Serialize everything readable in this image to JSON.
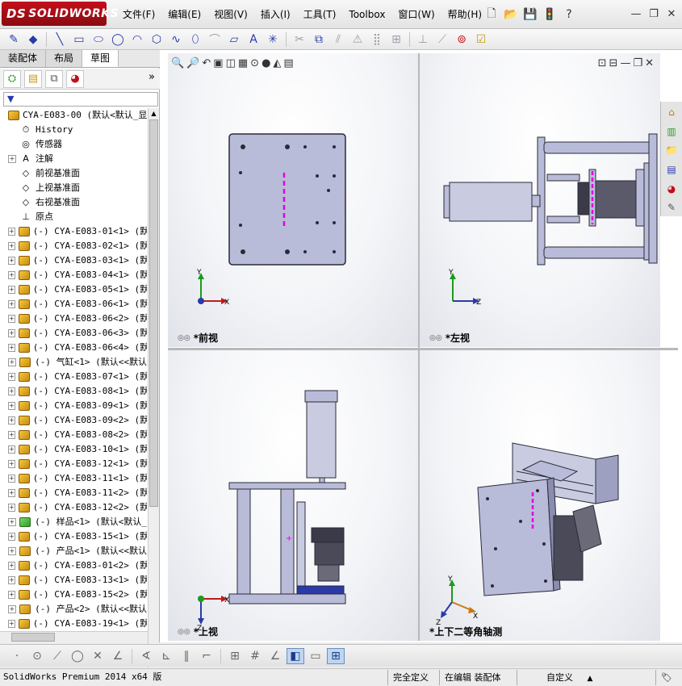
{
  "app": {
    "brand": "SOLIDWORKS",
    "brand_prefix": "DS"
  },
  "menu": [
    "文件(F)",
    "编辑(E)",
    "视图(V)",
    "插入(I)",
    "工具(T)",
    "Toolbox",
    "窗口(W)",
    "帮助(H)"
  ],
  "tabs": [
    {
      "label": "装配体",
      "active": false
    },
    {
      "label": "布局",
      "active": false
    },
    {
      "label": "草图",
      "active": true
    }
  ],
  "tree": {
    "filter_icon": "filter-icon",
    "root": "CYA-E083-00  (默认<默认_显",
    "fixed_items": [
      {
        "label": "History",
        "icon": "history-icon",
        "expand": false
      },
      {
        "label": "传感器",
        "icon": "sensor-icon",
        "expand": false
      },
      {
        "label": "注解",
        "icon": "annotation-icon",
        "expand": true
      },
      {
        "label": "前视基准面",
        "icon": "plane-icon",
        "expand": false
      },
      {
        "label": "上视基准面",
        "icon": "plane-icon",
        "expand": false
      },
      {
        "label": "右视基准面",
        "icon": "plane-icon",
        "expand": false
      },
      {
        "label": "原点",
        "icon": "origin-icon",
        "expand": false
      }
    ],
    "components": [
      {
        "label": "(-) CYA-E083-01<1> (默认",
        "color": "yellow"
      },
      {
        "label": "(-) CYA-E083-02<1> (默认",
        "color": "yellow"
      },
      {
        "label": "(-) CYA-E083-03<1> (默认",
        "color": "yellow"
      },
      {
        "label": "(-) CYA-E083-04<1> (默认",
        "color": "yellow"
      },
      {
        "label": "(-) CYA-E083-05<1> (默认",
        "color": "yellow"
      },
      {
        "label": "(-) CYA-E083-06<1> (默认",
        "color": "yellow"
      },
      {
        "label": "(-) CYA-E083-06<2> (默认",
        "color": "yellow"
      },
      {
        "label": "(-) CYA-E083-06<3> (默认",
        "color": "yellow"
      },
      {
        "label": "(-) CYA-E083-06<4> (默认",
        "color": "yellow"
      },
      {
        "label": "(-) 气缸<1> (默认<<默认",
        "color": "yellow"
      },
      {
        "label": "(-) CYA-E083-07<1> (默认",
        "color": "yellow"
      },
      {
        "label": "(-) CYA-E083-08<1> (默认",
        "color": "yellow"
      },
      {
        "label": "(-) CYA-E083-09<1> (默认",
        "color": "yellow"
      },
      {
        "label": "(-) CYA-E083-09<2> (默认",
        "color": "yellow"
      },
      {
        "label": "(-) CYA-E083-08<2> (默认",
        "color": "yellow"
      },
      {
        "label": "(-) CYA-E083-10<1> (默认",
        "color": "yellow"
      },
      {
        "label": "(-) CYA-E083-12<1> (默认",
        "color": "yellow"
      },
      {
        "label": "(-) CYA-E083-11<1> (默认",
        "color": "yellow"
      },
      {
        "label": "(-) CYA-E083-11<2> (默认",
        "color": "yellow"
      },
      {
        "label": "(-) CYA-E083-12<2> (默认",
        "color": "yellow"
      },
      {
        "label": "(-) 样品<1> (默认<默认_",
        "color": "green"
      },
      {
        "label": "(-) CYA-E083-15<1> (默认",
        "color": "yellow"
      },
      {
        "label": "(-) 产品<1> (默认<<默认",
        "color": "yellow"
      },
      {
        "label": "(-) CYA-E083-01<2> (默认",
        "color": "yellow"
      },
      {
        "label": "(-) CYA-E083-13<1> (默认",
        "color": "yellow"
      },
      {
        "label": "(-) CYA-E083-15<2> (默认",
        "color": "yellow"
      },
      {
        "label": "(-) 产品<2> (默认<<默认",
        "color": "yellow"
      },
      {
        "label": "(-) CYA-E083-19<1> (默认",
        "color": "yellow"
      }
    ]
  },
  "viewports": {
    "front": {
      "label": "*前视",
      "axis_x": "X",
      "axis_y": "Y"
    },
    "left": {
      "label": "*左视",
      "axis_y": "Y",
      "axis_z": "Z"
    },
    "top": {
      "label": "*上视",
      "axis_x": "X",
      "axis_z": "Z"
    },
    "iso": {
      "label": "*上下二等角轴测",
      "axis_x": "X",
      "axis_y": "Y",
      "axis_z": "Z"
    }
  },
  "statusbar": {
    "product": "SolidWorks Premium 2014 x64 版",
    "state": "完全定义",
    "mode": "在编辑 装配体",
    "units": "自定义",
    "units_arrow": "▲"
  },
  "colors": {
    "accent": "#c2101a",
    "model_fill": "#b9bcd8",
    "model_dark": "#2a2a3a",
    "highlight": "#e000e0"
  }
}
